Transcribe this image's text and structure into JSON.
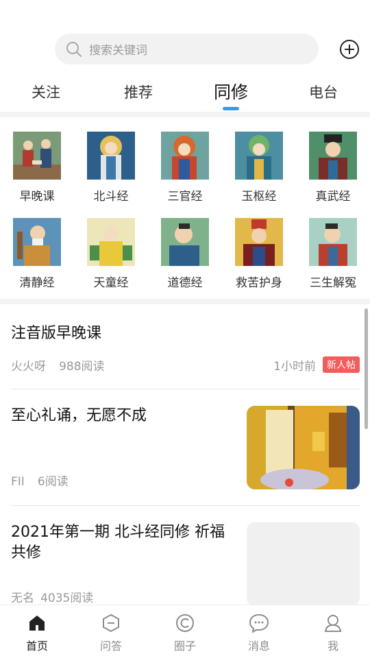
{
  "search": {
    "placeholder": "搜索关键词"
  },
  "tabs": [
    {
      "label": "关注"
    },
    {
      "label": "推荐"
    },
    {
      "label": "同修"
    },
    {
      "label": "电台"
    }
  ],
  "sutras": [
    {
      "label": "早晚课"
    },
    {
      "label": "北斗经"
    },
    {
      "label": "三官经"
    },
    {
      "label": "玉枢经"
    },
    {
      "label": "真武经"
    },
    {
      "label": "清静经"
    },
    {
      "label": "天童经"
    },
    {
      "label": "道德经"
    },
    {
      "label": "救苦护身"
    },
    {
      "label": "三生解冤"
    }
  ],
  "posts": [
    {
      "title": "注音版早晚课",
      "author": "火火呀",
      "reads": "988阅读",
      "time": "1小时前",
      "badge": "新人帖"
    },
    {
      "title": "至心礼诵，无愿不成",
      "author": "FII",
      "reads": "6阅读"
    },
    {
      "title": "2021年第一期 北斗经同修 祈福共修",
      "author": "无名",
      "reads": "4035阅读"
    }
  ],
  "nav": [
    {
      "label": "首页",
      "icon": "home-icon"
    },
    {
      "label": "问答",
      "icon": "qa-icon"
    },
    {
      "label": "圈子",
      "icon": "circle-icon"
    },
    {
      "label": "消息",
      "icon": "message-icon"
    },
    {
      "label": "我",
      "icon": "profile-icon"
    }
  ],
  "colors": {
    "accent": "#2a9df4",
    "badge": "#f45b5b",
    "muted": "#999999"
  }
}
